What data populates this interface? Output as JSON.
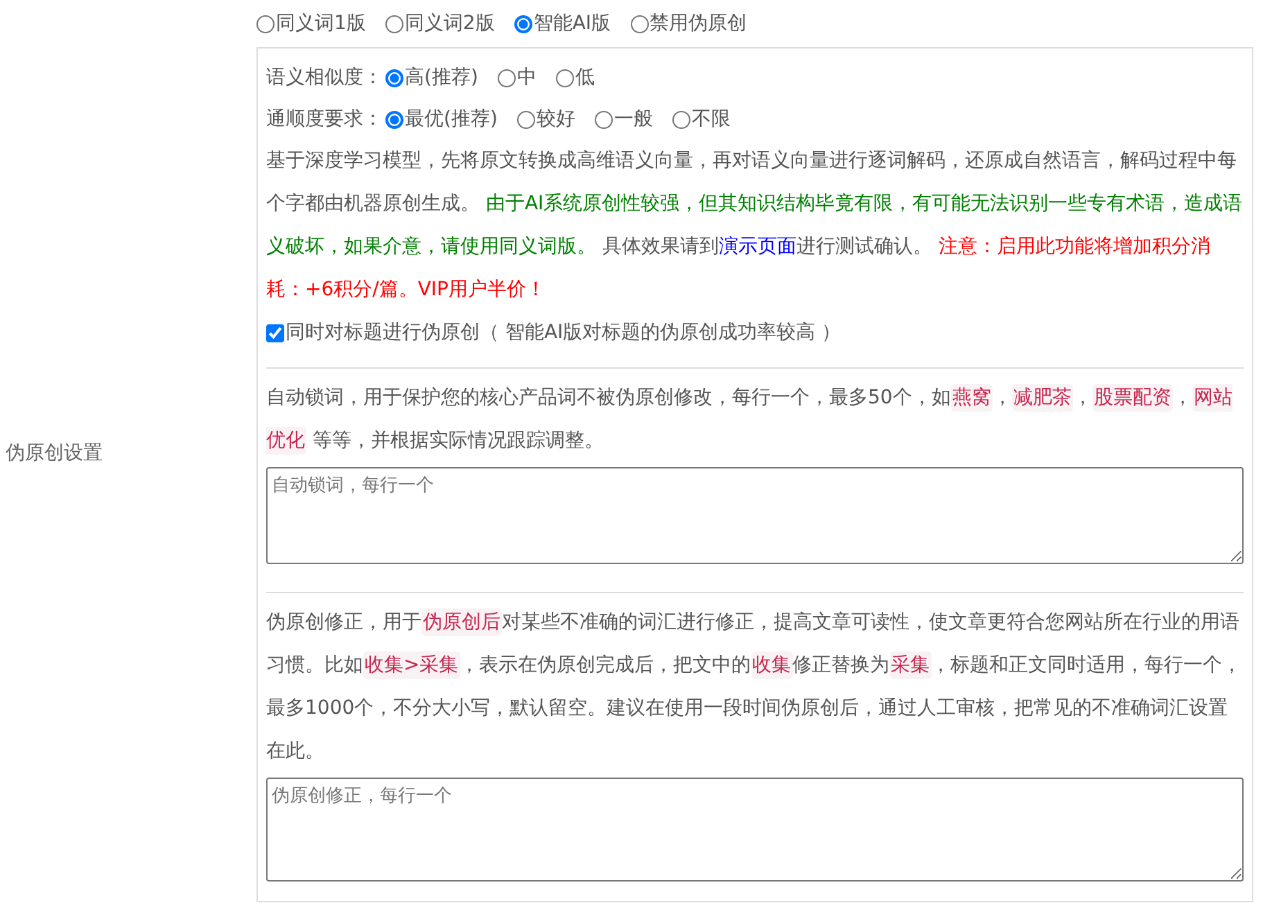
{
  "modes": [
    {
      "label": "同义词1版",
      "selected": false
    },
    {
      "label": "同义词2版",
      "selected": false
    },
    {
      "label": "智能AI版",
      "selected": true
    },
    {
      "label": "禁用伪原创",
      "selected": false
    }
  ],
  "settings_label": "伪原创设置",
  "similarity": {
    "label": "语义相似度：",
    "options": [
      {
        "label": "高(推荐)",
        "selected": true
      },
      {
        "label": "中",
        "selected": false
      },
      {
        "label": "低",
        "selected": false
      }
    ]
  },
  "fluency": {
    "label": "通顺度要求：",
    "options": [
      {
        "label": "最优(推荐)",
        "selected": true
      },
      {
        "label": "较好",
        "selected": false
      },
      {
        "label": "一般",
        "selected": false
      },
      {
        "label": "不限",
        "selected": false
      }
    ]
  },
  "description": [
    {
      "kind": "plain",
      "text": "基于深度学习模型，先将原文转换成高维语义向量，再对语义向量进行逐词解码，还原成自然语言，解码过程中每个字都由机器原创生成。 "
    },
    {
      "kind": "green",
      "text": "由于AI系统原创性较强，但其知识结构毕竟有限，有可能无法识别一些专有术语，造成语义破坏，如果介意，请使用同义词版。"
    },
    {
      "kind": "plain",
      "text": " 具体效果请到"
    },
    {
      "kind": "link",
      "text": "演示页面"
    },
    {
      "kind": "plain",
      "text": "进行测试确认。 "
    },
    {
      "kind": "red",
      "text": "注意：启用此功能将增加积分消耗：+6积分/篇。VIP用户半价！"
    }
  ],
  "title_option": {
    "label": "同时对标题进行伪原创（ 智能AI版对标题的伪原创成功率较高 ）",
    "checked": true
  },
  "lock_words": {
    "description": [
      {
        "kind": "plain",
        "text": "自动锁词，用于保护您的核心产品词不被伪原创修改，每行一个，最多50个，如"
      },
      {
        "kind": "code",
        "text": "燕窝"
      },
      {
        "kind": "plain",
        "text": "，"
      },
      {
        "kind": "code",
        "text": "减肥茶"
      },
      {
        "kind": "plain",
        "text": "，"
      },
      {
        "kind": "code",
        "text": "股票配资"
      },
      {
        "kind": "plain",
        "text": "，"
      },
      {
        "kind": "code",
        "text": "网站优化"
      },
      {
        "kind": "plain",
        "text": " 等等，并根据实际情况跟踪调整。"
      }
    ],
    "placeholder": "自动锁词，每行一个"
  },
  "corrections": {
    "description": [
      {
        "kind": "plain",
        "text": "伪原创修正，用于"
      },
      {
        "kind": "code",
        "text": "伪原创后"
      },
      {
        "kind": "plain",
        "text": "对某些不准确的词汇进行修正，提高文章可读性，使文章更符合您网站所在行业的用语习惯。比如"
      },
      {
        "kind": "code",
        "text": "收集>采集"
      },
      {
        "kind": "plain",
        "text": "，表示在伪原创完成后，把文中的"
      },
      {
        "kind": "code",
        "text": "收集"
      },
      {
        "kind": "plain",
        "text": "修正替换为"
      },
      {
        "kind": "code",
        "text": "采集"
      },
      {
        "kind": "plain",
        "text": "，标题和正文同时适用，每行一个，最多1000个，不分大小写，默认留空。建议在使用一段时间伪原创后，通过人工审核，把常见的不准确词汇设置在此。"
      }
    ],
    "placeholder": "伪原创修正，每行一个"
  }
}
